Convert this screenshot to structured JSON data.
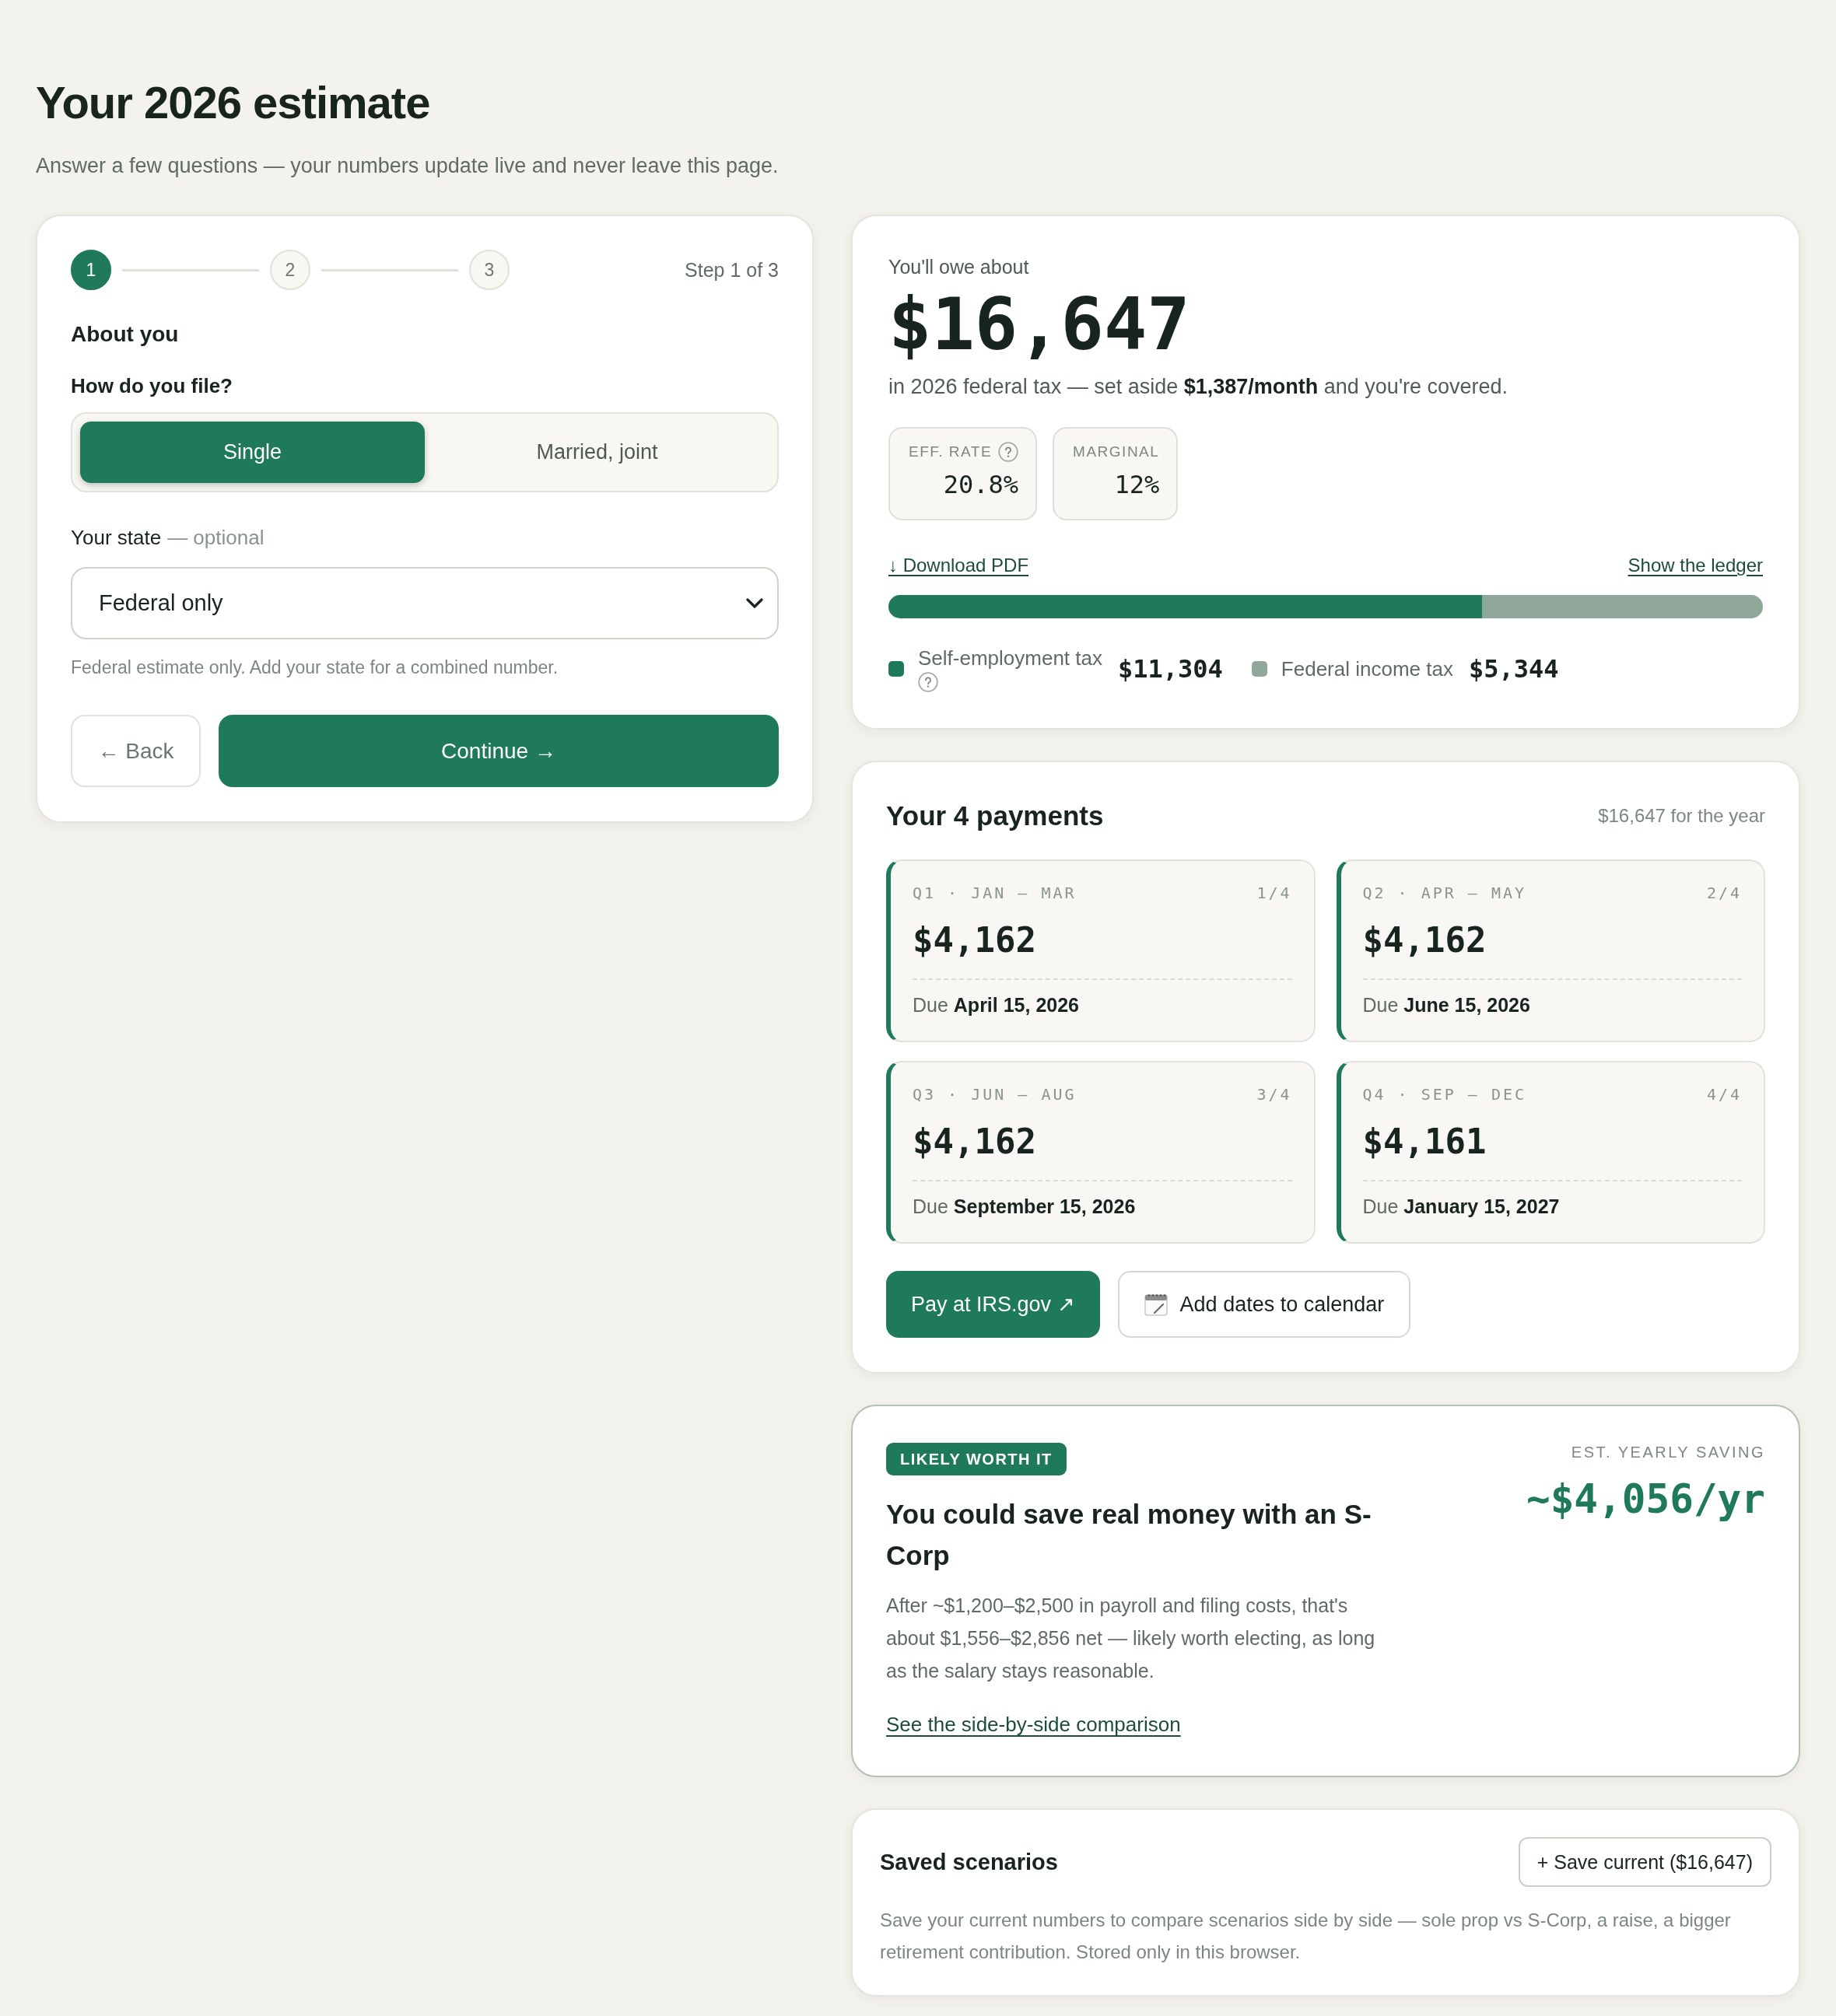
{
  "header": {
    "title": "Your 2026 estimate",
    "subtitle": "Answer a few questions — your numbers update live and never leave this page."
  },
  "wizard": {
    "steps": [
      {
        "label": "1",
        "selected": true
      },
      {
        "label": "2",
        "selected": false
      },
      {
        "label": "3",
        "selected": false
      }
    ],
    "step_caption": "Step 1 of 3",
    "section_title": "About you",
    "filing_question": "How do you file?",
    "filing_options": [
      {
        "label": "Single",
        "selected": true
      },
      {
        "label": "Married, joint",
        "selected": false
      }
    ],
    "state_label": "Your state",
    "state_note": "— optional",
    "state_select": {
      "value": "Federal only"
    },
    "hint": "Federal estimate only. Add your state for a combined number.",
    "buttons": [
      {
        "label": "← Back",
        "kind": "secondary"
      },
      {
        "label": "Continue →",
        "kind": "primary"
      }
    ]
  },
  "summary": {
    "caption": "You'll owe about",
    "total": "$16,647",
    "sentence": "in 2026 federal tax — set aside **$1,387/month** and you're covered.",
    "stats": [
      {
        "label": "EFF. RATE",
        "value": "20.8%",
        "help": true
      },
      {
        "label": "MARGINAL",
        "value": "12%",
        "help": false
      }
    ],
    "download_link": "↓ Download PDF",
    "ledger_link": "Show the ledger",
    "breakdown": [
      {
        "label": "Self-employment tax",
        "amount": "$11,304",
        "level": 0.679,
        "color": "#1f7a5c",
        "help": true
      },
      {
        "label": "Federal income tax",
        "amount": "$5,344",
        "level": 0.321,
        "color": "#8fa89a",
        "help": false
      }
    ]
  },
  "payments": {
    "title": "Your 4 payments",
    "total_note": "$16,647 for the year",
    "quarters": [
      {
        "period": "Q1 · JAN – MAR",
        "index": "1/4",
        "amount": "$4,162",
        "due": "Due **April 15, 2026**"
      },
      {
        "period": "Q2 · APR – MAY",
        "index": "2/4",
        "amount": "$4,162",
        "due": "Due **June 15, 2026**"
      },
      {
        "period": "Q3 · JUN – AUG",
        "index": "3/4",
        "amount": "$4,162",
        "due": "Due **September 15, 2026**"
      },
      {
        "period": "Q4 · SEP – DEC",
        "index": "4/4",
        "amount": "$4,161",
        "due": "Due **January 15, 2027**"
      }
    ],
    "actions": [
      {
        "label": "Pay at IRS.gov ↗",
        "kind": "primary"
      },
      {
        "label": "Add dates to calendar",
        "kind": "calendar"
      }
    ]
  },
  "scorp": {
    "badge": "LIKELY WORTH IT",
    "title": "You could save real money with an S-Corp",
    "body": "After ~$1,200–$2,500 in payroll and filing costs, that's about $1,556–$2,856 net — likely worth electing, as long as the salary stays reasonable.",
    "link": "See the side-by-side comparison",
    "saving_label": "EST. YEARLY SAVING",
    "saving_value": "~$4,056/yr"
  },
  "saved": {
    "title": "Saved scenarios",
    "save_button": "+ Save current ($16,647)",
    "description": "Save your current numbers to compare scenarios side by side — sole prop vs S-Corp, a raise, a bigger retirement contribution. Stored only in this browser."
  }
}
